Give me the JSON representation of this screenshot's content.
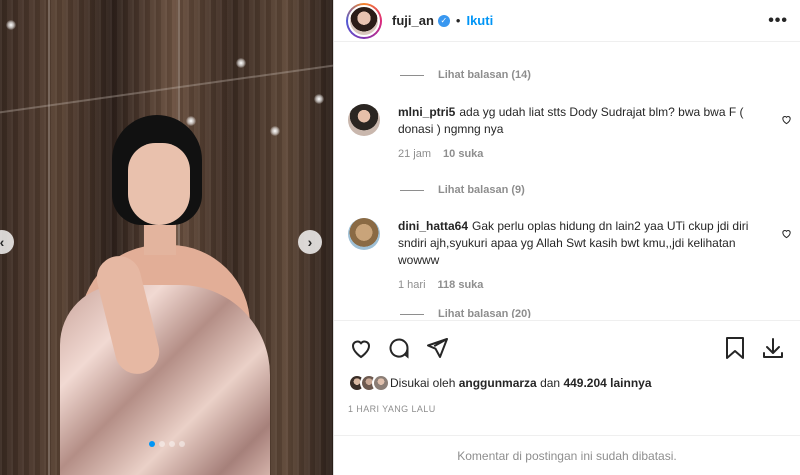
{
  "header": {
    "username": "fuji_an",
    "separator": "•",
    "follow_label": "Ikuti",
    "more_label": "•••"
  },
  "comments": [
    {
      "replies_label": "Lihat balasan (14)"
    },
    {
      "username": "mlni_ptri5",
      "text": "ada yg udah liat stts Dody Sudrajat blm? bwa bwa F ( donasi ) ngmng nya",
      "time": "21 jam",
      "likes": "10 suka",
      "avatar_color": "#2b2622"
    },
    {
      "replies_label": "Lihat balasan (9)"
    },
    {
      "username": "dini_hatta64",
      "text": "Gak perlu oplas hidung dn lain2 yaa UTi ckup jdi diri sndiri ajh,syukuri apaa yg Allah Swt kasih bwt kmu,,jdi kelihatan wowww",
      "time": "1 hari",
      "likes": "118 suka",
      "avatar_color": "#a98a5c"
    },
    {
      "replies_label": "Lihat balasan (20)"
    }
  ],
  "likes": {
    "prefix": "Disukai oleh",
    "user": "anggunmarza",
    "connector": "dan",
    "count": "449.204 lainnya"
  },
  "time_ago": "1 HARI YANG LALU",
  "footer": "Komentar di postingan ini sudah dibatasi.",
  "carousel": {
    "active_index": 0,
    "count": 4
  },
  "colors": {
    "accent": "#0095f6",
    "text": "#262626",
    "muted": "#8e8e8e"
  },
  "icons": [
    "chevron-left-icon",
    "chevron-right-icon",
    "heart-icon",
    "comment-icon",
    "share-icon",
    "bookmark-icon",
    "download-icon",
    "more-icon",
    "verified-icon"
  ]
}
